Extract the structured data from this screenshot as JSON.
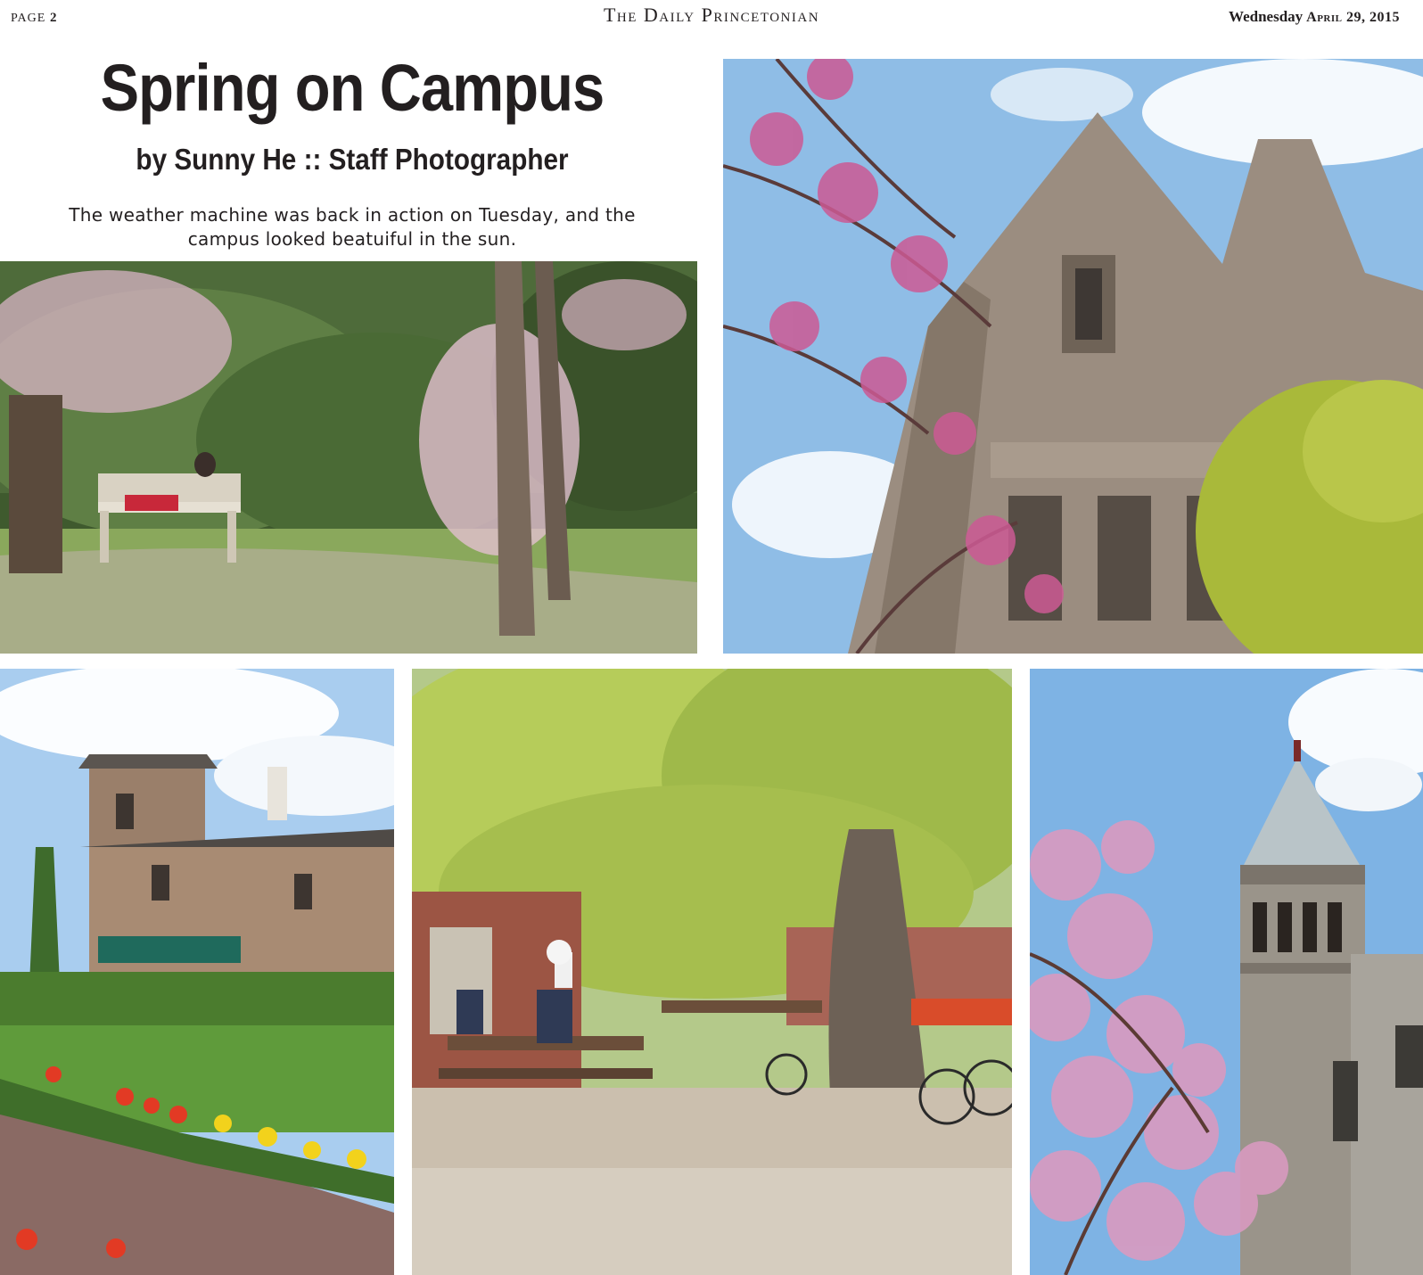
{
  "header": {
    "page_label": "PAGE",
    "page_number": "2",
    "masthead": "The Daily Princetonian",
    "weekday": "Wednesday",
    "date": "April 29, 2015"
  },
  "article": {
    "headline": "Spring on Campus",
    "byline": "by Sunny He :: Staff Photographer",
    "dek": "The weather machine was back in action on Tuesday, and the campus looked beatuiful in the sun."
  },
  "colors": {
    "text": "#231f20",
    "sky": "#8fbde6",
    "stone": "#9b8d80",
    "foliage": "#7fa84a",
    "blossom": "#d98ab8"
  }
}
